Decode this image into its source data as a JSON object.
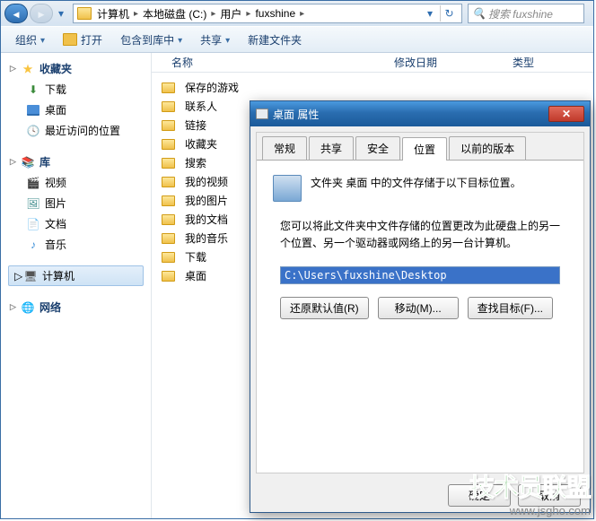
{
  "nav": {
    "crumbs": [
      "计算机",
      "本地磁盘 (C:)",
      "用户",
      "fuxshine"
    ],
    "search_placeholder": "搜索 fuxshine"
  },
  "toolbar": {
    "organize": "组织",
    "open": "打开",
    "include": "包含到库中",
    "share": "共享",
    "newfolder": "新建文件夹"
  },
  "sidebar": {
    "favorites": {
      "title": "收藏夹",
      "items": [
        "下载",
        "桌面",
        "最近访问的位置"
      ]
    },
    "libraries": {
      "title": "库",
      "items": [
        "视频",
        "图片",
        "文档",
        "音乐"
      ]
    },
    "computer": {
      "title": "计算机"
    },
    "network": {
      "title": "网络"
    }
  },
  "columns": {
    "name": "名称",
    "date": "修改日期",
    "type": "类型"
  },
  "files": [
    "保存的游戏",
    "联系人",
    "链接",
    "收藏夹",
    "搜索",
    "我的视频",
    "我的图片",
    "我的文档",
    "我的音乐",
    "下载",
    "桌面"
  ],
  "dialog": {
    "title": "桌面 属性",
    "tabs": [
      "常规",
      "共享",
      "安全",
      "位置",
      "以前的版本"
    ],
    "active_tab": 3,
    "loc_text1": "文件夹 桌面 中的文件存储于以下目标位置。",
    "loc_text2": "您可以将此文件夹中文件存储的位置更改为此硬盘上的另一个位置、另一个驱动器或网络上的另一台计算机。",
    "path": "C:\\Users\\fuxshine\\Desktop",
    "btn_restore": "还原默认值(R)",
    "btn_move": "移动(M)...",
    "btn_find": "查找目标(F)...",
    "btn_ok": "确定",
    "btn_cancel": "取消"
  },
  "watermark": {
    "big": "技术员联盟",
    "url": "www.jsgho.com"
  }
}
